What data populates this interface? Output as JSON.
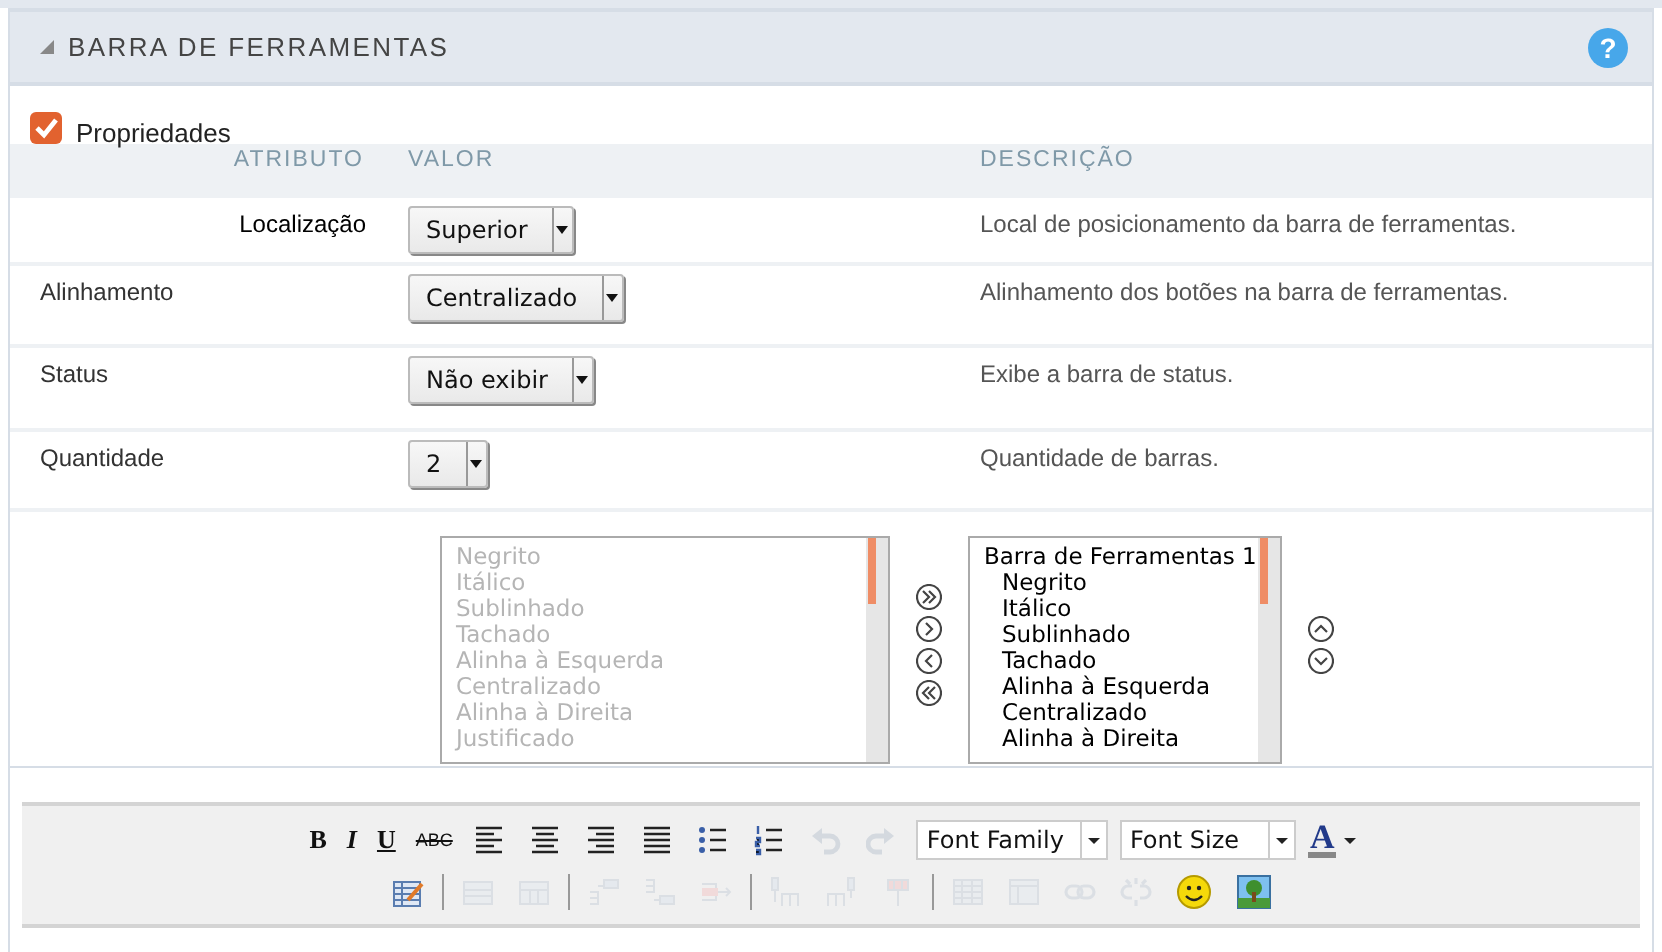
{
  "section": {
    "title": "BARRA DE FERRAMENTAS",
    "expanded": true,
    "help": "?"
  },
  "properties": {
    "label": "Propriedades",
    "checked": true
  },
  "table": {
    "columns": [
      "ATRIBUTO",
      "VALOR",
      "DESCRIÇÃO"
    ],
    "rows": [
      {
        "attribute": "Localização",
        "emphasis": true,
        "value": "Superior",
        "description": "Local de posicionamento da barra de ferramentas."
      },
      {
        "attribute": "Alinhamento",
        "emphasis": false,
        "value": "Centralizado",
        "description": "Alinhamento dos botões na barra de ferramentas."
      },
      {
        "attribute": "Status",
        "emphasis": false,
        "value": "Não exibir",
        "description": "Exibe a barra de status."
      },
      {
        "attribute": "Quantidade",
        "emphasis": false,
        "value": "2",
        "description": "Quantidade de barras."
      }
    ]
  },
  "available_list": {
    "items": [
      {
        "label": "Negrito",
        "disabled": true
      },
      {
        "label": "Itálico",
        "disabled": true
      },
      {
        "label": "Sublinhado",
        "disabled": true
      },
      {
        "label": "Tachado",
        "disabled": true
      },
      {
        "label": "Alinha à Esquerda",
        "disabled": true
      },
      {
        "label": "Centralizado",
        "disabled": true
      },
      {
        "label": "Alinha à Direita",
        "disabled": true
      },
      {
        "label": "Justificado",
        "disabled": true
      }
    ]
  },
  "transfer_buttons": [
    {
      "kind": "all-right"
    },
    {
      "kind": "right"
    },
    {
      "kind": "left"
    },
    {
      "kind": "all-left"
    }
  ],
  "selected_list": {
    "items": [
      {
        "label": "Barra de Ferramentas 1",
        "children": [
          {
            "label": "Negrito"
          },
          {
            "label": "Itálico"
          },
          {
            "label": "Sublinhado"
          },
          {
            "label": "Tachado"
          },
          {
            "label": "Alinha à Esquerda"
          },
          {
            "label": "Centralizado"
          },
          {
            "label": "Alinha à Direita"
          }
        ]
      }
    ]
  },
  "order_buttons": [
    {
      "kind": "up"
    },
    {
      "kind": "down"
    }
  ],
  "editor_toolbar": {
    "rows": [
      [
        {
          "kind": "bold",
          "glyph": "B",
          "disabled": false
        },
        {
          "kind": "italic",
          "glyph": "I",
          "disabled": false
        },
        {
          "kind": "underline",
          "glyph": "U",
          "disabled": false
        },
        {
          "kind": "strike",
          "glyph": "ABC",
          "disabled": false
        },
        {
          "kind": "align-left",
          "disabled": false
        },
        {
          "kind": "align-center",
          "disabled": false
        },
        {
          "kind": "align-right",
          "disabled": false
        },
        {
          "kind": "justify",
          "disabled": false
        },
        {
          "kind": "bullets",
          "disabled": false
        },
        {
          "kind": "numbers",
          "disabled": false
        },
        {
          "kind": "undo",
          "disabled": true
        },
        {
          "kind": "redo",
          "disabled": true
        },
        {
          "kind": "select",
          "label": "Font Family"
        },
        {
          "kind": "select",
          "label": "Font Size"
        },
        {
          "kind": "font-color",
          "glyph": "A",
          "color": "#888888"
        }
      ],
      [
        {
          "kind": "table",
          "disabled": false
        },
        {
          "kind": "sep"
        },
        {
          "kind": "row-props",
          "disabled": true
        },
        {
          "kind": "cell-props",
          "disabled": true
        },
        {
          "kind": "sep"
        },
        {
          "kind": "row-before",
          "disabled": true
        },
        {
          "kind": "row-after",
          "disabled": true
        },
        {
          "kind": "row-delete",
          "disabled": true
        },
        {
          "kind": "sep"
        },
        {
          "kind": "col-before",
          "disabled": true
        },
        {
          "kind": "col-after",
          "disabled": true
        },
        {
          "kind": "col-delete",
          "disabled": true
        },
        {
          "kind": "sep"
        },
        {
          "kind": "split",
          "disabled": true
        },
        {
          "kind": "merge",
          "disabled": true
        },
        {
          "kind": "link",
          "disabled": true
        },
        {
          "kind": "unlink",
          "disabled": true
        },
        {
          "kind": "smiley",
          "disabled": false
        },
        {
          "kind": "image",
          "disabled": false
        }
      ]
    ]
  }
}
